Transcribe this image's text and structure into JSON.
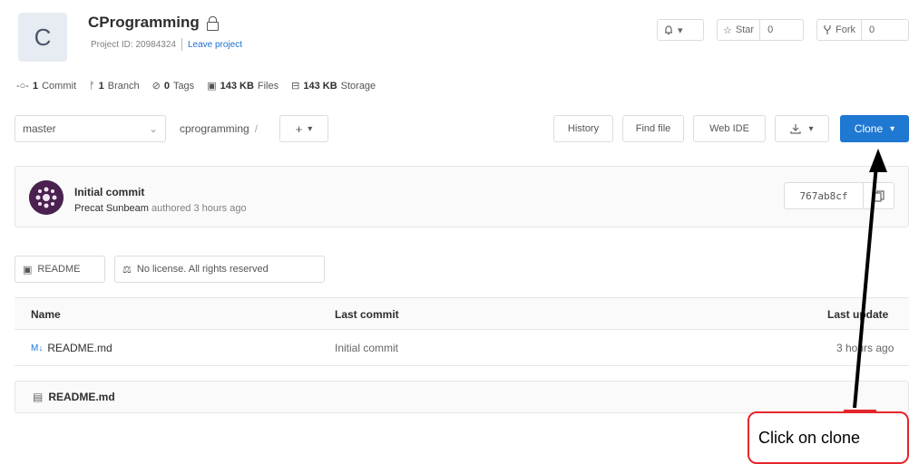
{
  "project": {
    "avatar_letter": "C",
    "name": "CProgramming",
    "id_text": "Project ID: 20984324",
    "leave_link": "Leave project"
  },
  "header_actions": {
    "notification_label": "▾",
    "star_label": "Star",
    "star_count": "0",
    "fork_label": "Fork",
    "fork_count": "0"
  },
  "stats": [
    {
      "value": "1",
      "label": "Commit",
      "icon": "commit-icon"
    },
    {
      "value": "1",
      "label": "Branch",
      "icon": "branch-icon"
    },
    {
      "value": "0",
      "label": "Tags",
      "icon": "tag-icon"
    },
    {
      "value": "143 KB",
      "label": "Files",
      "icon": "file-icon"
    },
    {
      "value": "143 KB",
      "label": "Storage",
      "icon": "storage-icon"
    }
  ],
  "toolbar": {
    "branch": "master",
    "path_root": "cprogramming",
    "path_sep": "/",
    "add_label": "+",
    "history_label": "History",
    "find_file_label": "Find file",
    "web_ide_label": "Web IDE",
    "clone_label": "Clone"
  },
  "last_commit": {
    "title": "Initial commit",
    "author": "Precat Sunbeam",
    "meta": "authored 3 hours ago",
    "sha": "767ab8cf"
  },
  "badges": {
    "readme": "README",
    "license": "No license. All rights reserved"
  },
  "table": {
    "headers": [
      "Name",
      "Last commit",
      "Last update"
    ],
    "rows": [
      {
        "name": "README.md",
        "commit": "Initial commit",
        "updated": "3 hours ago"
      }
    ]
  },
  "readme_file": "README.md",
  "annotation": {
    "text": "Click on clone",
    "color": "#e4262b"
  },
  "colors": {
    "primary": "#1f78d1",
    "link": "#1f6fd0"
  }
}
